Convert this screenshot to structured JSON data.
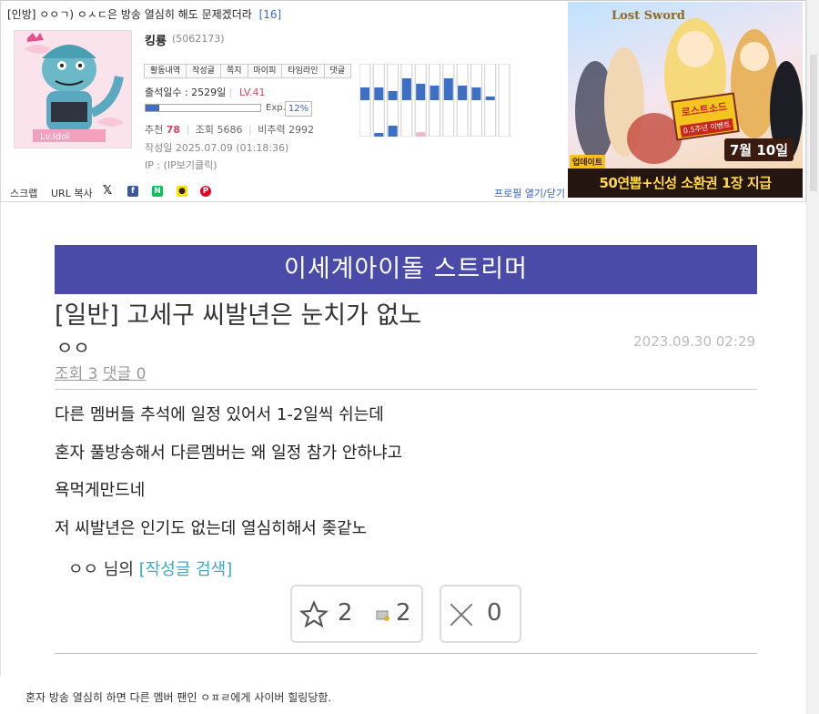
{
  "post_header": {
    "title": "[인방] ㅇㅇㄱ) ㅇㅅㄷ은 방송 열심히 해도 문제겠더라",
    "comment_count": "[16]"
  },
  "profile": {
    "nickname": "킹룡",
    "user_id": "(5062173)",
    "tabs": [
      "활동내역",
      "작성글",
      "쪽지",
      "마이피",
      "타임라인",
      "댓글"
    ],
    "attendance": "출석일수 : 2529일",
    "level": "LV.41",
    "exp_label": "Exp.",
    "exp_percent": "12%",
    "exp_fraction": 0.12,
    "recommend_label": "추천",
    "recommend_value": "78",
    "views_label": "조회",
    "views_value": "5686",
    "bichu_label": "비추력",
    "bichu_value": "2992",
    "written": "작성일 2025.07.09 (01:18:36)",
    "ip": "IP : (IP보기클릭)",
    "activity_bars": {
      "upper": [
        0.35,
        0.35,
        0.25,
        0.6,
        0.45,
        0.4,
        0.6,
        0.4,
        0.35,
        0.1,
        0
      ],
      "lower": [
        0,
        0.1,
        0.3,
        0,
        0.12,
        0,
        0,
        0,
        0,
        0,
        0
      ],
      "lower_colors": [
        "#3d6fc4",
        "#3d6fc4",
        "#3d6fc4",
        "#3d6fc4",
        "#f2b7c7",
        "#3d6fc4",
        "#3d6fc4",
        "#3d6fc4",
        "#3d6fc4",
        "#3d6fc4",
        "#3d6fc4"
      ]
    }
  },
  "share": {
    "scrap": "스크랩",
    "url_copy": "URL 복사",
    "profile_toggle": "프로필 열기/닫기"
  },
  "ad": {
    "brand": "Lost Sword",
    "tag_line1": "로스트소드",
    "tag_line2": "0.5주년 이벤트",
    "date": "7월 10일",
    "release": "업데이트",
    "bottom": "50연뽑+신성 소환권 1장 지급"
  },
  "post": {
    "gallery": "이세계아이돌 스트리머",
    "title": "[일반] 고세구 씨발년은 눈치가 없노",
    "author": "ㅇㅇ",
    "date": "2023.09.30 02:29",
    "views": "조회 3",
    "comments": "댓글 0",
    "lines": [
      "다른 멤버들 추석에 일정 있어서 1-2일씩 쉬는데",
      "혼자 풀방송해서 다른멤버는 왜 일정 참가 안하냐고",
      "욕먹게만드네",
      "저 씨발년은 인기도 없는데 열심히해서 좆같노"
    ],
    "author_suffix": "ㅇㅇ 님의",
    "search_link": "[작성글 검색]",
    "recommend_count": "2",
    "fix_count": "2",
    "dislike_count": "0"
  },
  "caption": "혼자 방송 열심히 하면 다른 멤버 팬인 ㅇㅍㄹ에게 사이버 힐링당함.",
  "colors": {
    "gallery_header": "#4a4aa8",
    "level_red": "#d9455f",
    "link_blue": "#3b61c0",
    "search_link": "#3ea8c6"
  }
}
